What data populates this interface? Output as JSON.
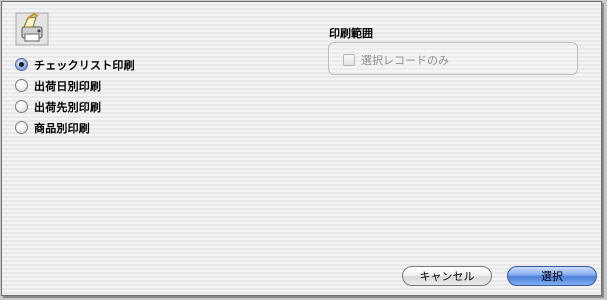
{
  "app_icon": "printer-icon",
  "print_options": [
    {
      "label": "チェックリスト印刷",
      "selected": true
    },
    {
      "label": "出荷日別印刷",
      "selected": false
    },
    {
      "label": "出荷先別印刷",
      "selected": false
    },
    {
      "label": "商品別印刷",
      "selected": false
    }
  ],
  "print_range": {
    "title": "印刷範囲",
    "selected_only_label": "選択レコードのみ",
    "selected_only_checked": false,
    "selected_only_enabled": false
  },
  "buttons": {
    "cancel_label": "キャンセル",
    "select_label": "選択"
  },
  "colors": {
    "accent": "#5c7fc4",
    "default_button": "#4f7fd6"
  }
}
